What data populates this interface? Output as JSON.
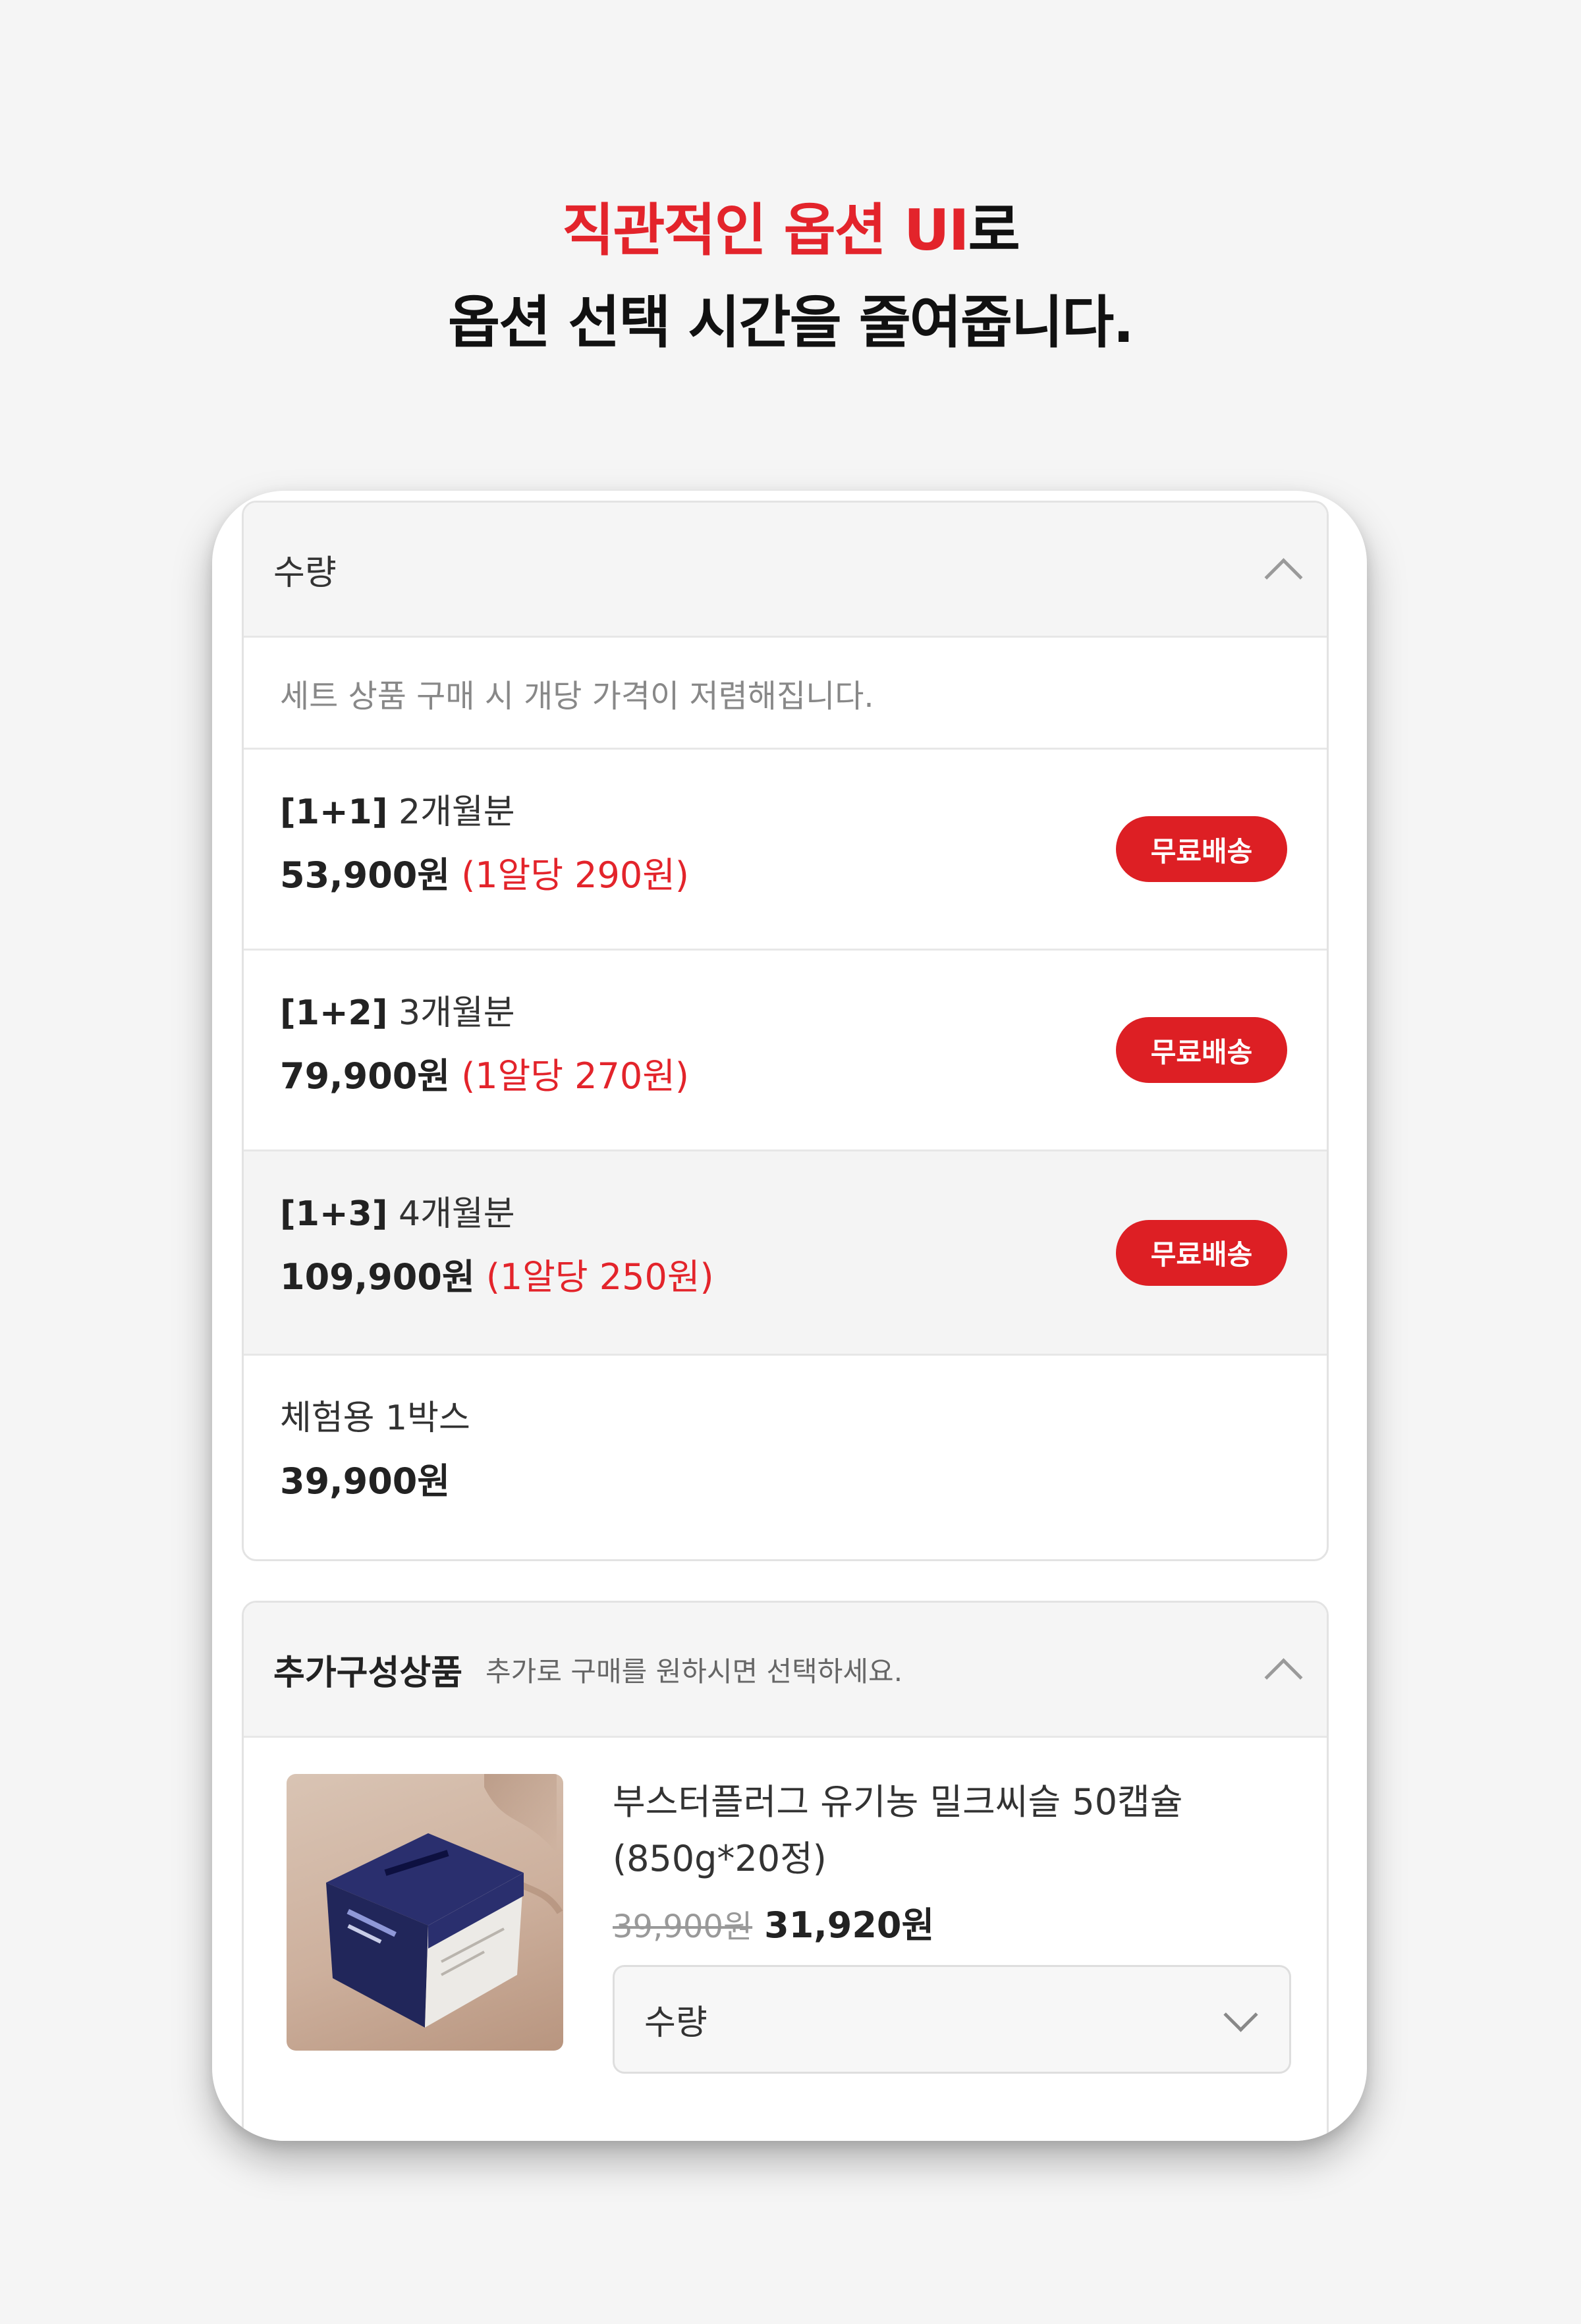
{
  "headline": {
    "line1_red": "직관적인 옵션 UI",
    "line1_dark": "로",
    "line2": "옵션 선택 시간을 줄여줍니다."
  },
  "quantity_panel": {
    "title": "수량",
    "notice": "세트 상품 구매 시 개당 가격이 저렴해집니다.",
    "options": [
      {
        "tag": "[1+1]",
        "period": "2개월분",
        "price": "53,900원",
        "unit_price": "(1알당 290원)",
        "badge": "무료배송"
      },
      {
        "tag": "[1+2]",
        "period": "3개월분",
        "price": "79,900원",
        "unit_price": "(1알당 270원)",
        "badge": "무료배송"
      },
      {
        "tag": "[1+3]",
        "period": "4개월분",
        "price": "109,900원",
        "unit_price": "(1알당 250원)",
        "badge": "무료배송",
        "selected": true
      },
      {
        "name": "체험용 1박스",
        "price": "39,900원"
      }
    ]
  },
  "addon_panel": {
    "title": "추가구성상품",
    "subtitle": "추가로 구매를 원하시면 선택하세요.",
    "product": {
      "name_line1": "부스터플러그 유기농 밀크씨슬 50캡슐",
      "name_line2": "(850g*20정)",
      "original_price": "39,900원",
      "sale_price": "31,920원",
      "select_label": "수량"
    }
  },
  "colors": {
    "accent": "#e3242b",
    "badge": "#dd1f24"
  }
}
